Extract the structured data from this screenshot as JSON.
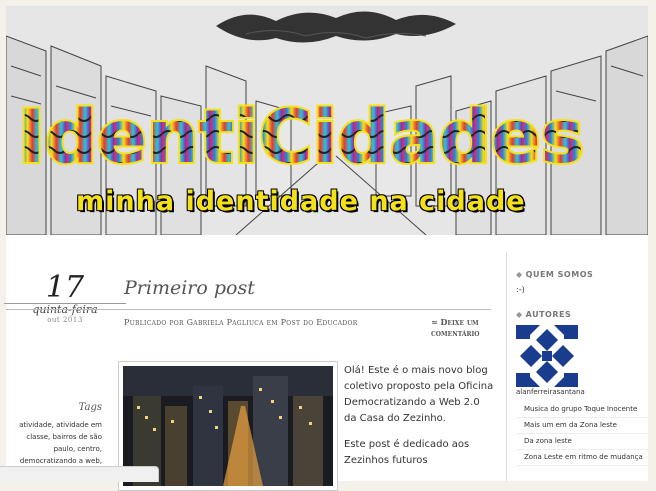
{
  "header": {
    "title": "IdentiCidades",
    "subtitle": "minha identidade na cidade"
  },
  "post": {
    "day": "17",
    "weekday": "quinta-feira",
    "month_year": "out 2013",
    "title": "Primeiro post",
    "meta": "Publicado por Gabriela Pagliuca em Post do Educador",
    "comment_link": "≈ Deixe um comentário",
    "paragraphs": [
      "Olá! Este é o mais novo blog coletivo proposto pela Oficina Democratizando a Web 2.0 da Casa do Zezinho.",
      "Este post é dedicado aos Zezinhos futuros"
    ],
    "tags_title": "Tags",
    "tags": "atividade, atividade em classe, bairros de são paulo, centro, democratizando a web,"
  },
  "sidebar": {
    "quem_somos_title": "QUEM SOMOS",
    "quem_somos_text": ":-)",
    "autores_title": "AUTORES",
    "author_name": "alanferreirasantana",
    "links": [
      "Musica do grupo Toque Inocente",
      "Mais um em da Zona leste",
      "Da zona leste",
      "Zona Leste em ritmo de mudança"
    ]
  },
  "colors": {
    "accent": "#f5e11a",
    "avatar": "#1a3c8f"
  }
}
